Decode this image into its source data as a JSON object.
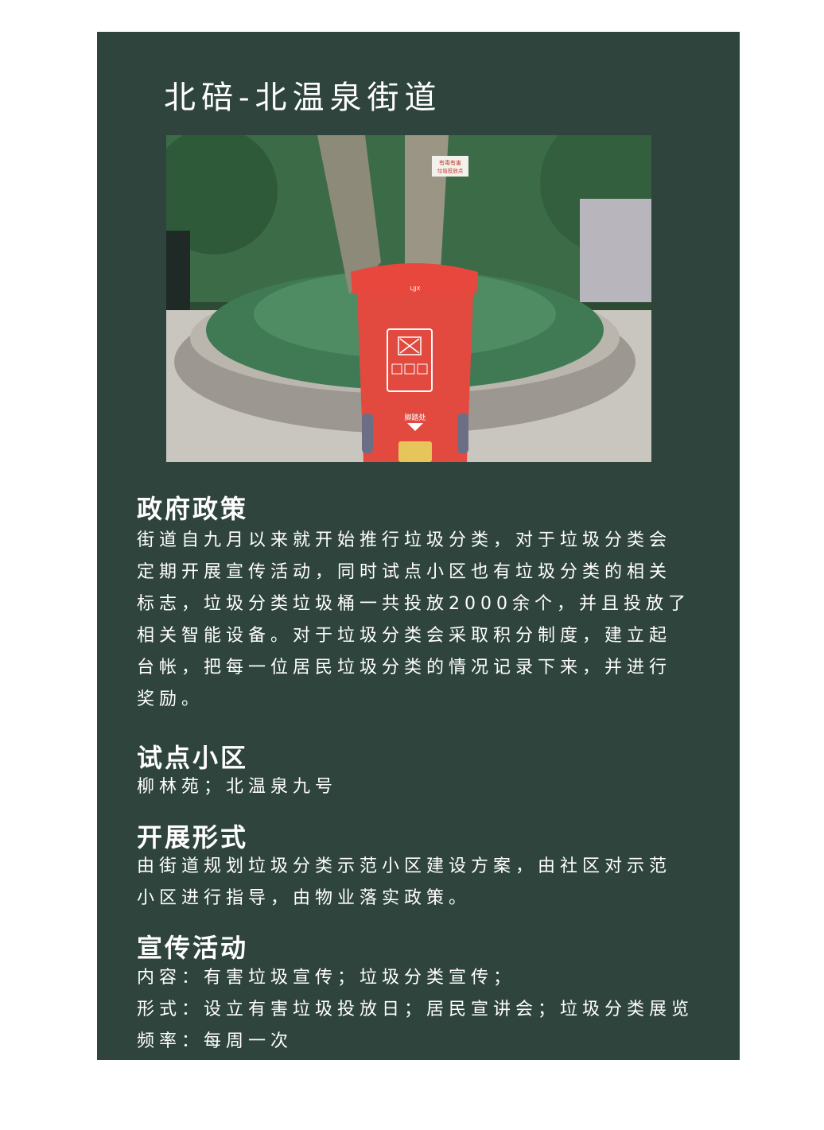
{
  "page_title": "北碚-北温泉街道",
  "colors": {
    "panel": "#2f443c",
    "text": "#ffffff",
    "bin_red": "#e8473d"
  },
  "photo": {
    "sign_line1": "有毒有害",
    "sign_line2": "垃圾投放点",
    "bin_brand": "LJJX",
    "bin_pedal_text": "脚踏处"
  },
  "sections": {
    "policy": {
      "heading": "政府政策",
      "lines": [
        "街道自九月以来就开始推行垃圾分类，对于垃圾分类会",
        "定期开展宣传活动，同时试点小区也有垃圾分类的相关",
        "标志，垃圾分类垃圾桶一共投放2000余个，并且投放了",
        "相关智能设备。对于垃圾分类会采取积分制度，建立起",
        "台帐，把每一位居民垃圾分类的情况记录下来，并进行",
        "奖励。"
      ]
    },
    "pilot": {
      "heading": "试点小区",
      "lines": [
        "柳林苑；北温泉九号"
      ]
    },
    "form": {
      "heading": "开展形式",
      "lines": [
        "由街道规划垃圾分类示范小区建设方案，由社区对示范",
        "小区进行指导，由物业落实政策。"
      ]
    },
    "promo": {
      "heading": "宣传活动",
      "lines": [
        "内容：有害垃圾宣传；垃圾分类宣传；",
        "形式：设立有害垃圾投放日；居民宣讲会；垃圾分类展览",
        "频率：每周一次"
      ]
    }
  }
}
